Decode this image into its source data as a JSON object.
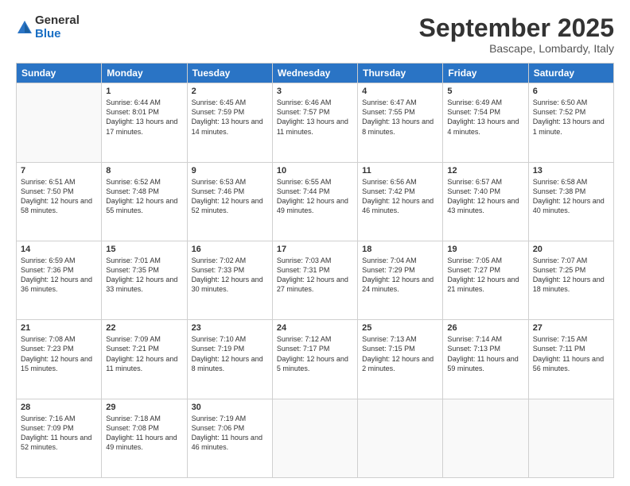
{
  "header": {
    "logo_general": "General",
    "logo_blue": "Blue",
    "month_title": "September 2025",
    "location": "Bascape, Lombardy, Italy"
  },
  "weekdays": [
    "Sunday",
    "Monday",
    "Tuesday",
    "Wednesday",
    "Thursday",
    "Friday",
    "Saturday"
  ],
  "weeks": [
    [
      {
        "day": "",
        "sunrise": "",
        "sunset": "",
        "daylight": ""
      },
      {
        "day": "1",
        "sunrise": "Sunrise: 6:44 AM",
        "sunset": "Sunset: 8:01 PM",
        "daylight": "Daylight: 13 hours and 17 minutes."
      },
      {
        "day": "2",
        "sunrise": "Sunrise: 6:45 AM",
        "sunset": "Sunset: 7:59 PM",
        "daylight": "Daylight: 13 hours and 14 minutes."
      },
      {
        "day": "3",
        "sunrise": "Sunrise: 6:46 AM",
        "sunset": "Sunset: 7:57 PM",
        "daylight": "Daylight: 13 hours and 11 minutes."
      },
      {
        "day": "4",
        "sunrise": "Sunrise: 6:47 AM",
        "sunset": "Sunset: 7:55 PM",
        "daylight": "Daylight: 13 hours and 8 minutes."
      },
      {
        "day": "5",
        "sunrise": "Sunrise: 6:49 AM",
        "sunset": "Sunset: 7:54 PM",
        "daylight": "Daylight: 13 hours and 4 minutes."
      },
      {
        "day": "6",
        "sunrise": "Sunrise: 6:50 AM",
        "sunset": "Sunset: 7:52 PM",
        "daylight": "Daylight: 13 hours and 1 minute."
      }
    ],
    [
      {
        "day": "7",
        "sunrise": "Sunrise: 6:51 AM",
        "sunset": "Sunset: 7:50 PM",
        "daylight": "Daylight: 12 hours and 58 minutes."
      },
      {
        "day": "8",
        "sunrise": "Sunrise: 6:52 AM",
        "sunset": "Sunset: 7:48 PM",
        "daylight": "Daylight: 12 hours and 55 minutes."
      },
      {
        "day": "9",
        "sunrise": "Sunrise: 6:53 AM",
        "sunset": "Sunset: 7:46 PM",
        "daylight": "Daylight: 12 hours and 52 minutes."
      },
      {
        "day": "10",
        "sunrise": "Sunrise: 6:55 AM",
        "sunset": "Sunset: 7:44 PM",
        "daylight": "Daylight: 12 hours and 49 minutes."
      },
      {
        "day": "11",
        "sunrise": "Sunrise: 6:56 AM",
        "sunset": "Sunset: 7:42 PM",
        "daylight": "Daylight: 12 hours and 46 minutes."
      },
      {
        "day": "12",
        "sunrise": "Sunrise: 6:57 AM",
        "sunset": "Sunset: 7:40 PM",
        "daylight": "Daylight: 12 hours and 43 minutes."
      },
      {
        "day": "13",
        "sunrise": "Sunrise: 6:58 AM",
        "sunset": "Sunset: 7:38 PM",
        "daylight": "Daylight: 12 hours and 40 minutes."
      }
    ],
    [
      {
        "day": "14",
        "sunrise": "Sunrise: 6:59 AM",
        "sunset": "Sunset: 7:36 PM",
        "daylight": "Daylight: 12 hours and 36 minutes."
      },
      {
        "day": "15",
        "sunrise": "Sunrise: 7:01 AM",
        "sunset": "Sunset: 7:35 PM",
        "daylight": "Daylight: 12 hours and 33 minutes."
      },
      {
        "day": "16",
        "sunrise": "Sunrise: 7:02 AM",
        "sunset": "Sunset: 7:33 PM",
        "daylight": "Daylight: 12 hours and 30 minutes."
      },
      {
        "day": "17",
        "sunrise": "Sunrise: 7:03 AM",
        "sunset": "Sunset: 7:31 PM",
        "daylight": "Daylight: 12 hours and 27 minutes."
      },
      {
        "day": "18",
        "sunrise": "Sunrise: 7:04 AM",
        "sunset": "Sunset: 7:29 PM",
        "daylight": "Daylight: 12 hours and 24 minutes."
      },
      {
        "day": "19",
        "sunrise": "Sunrise: 7:05 AM",
        "sunset": "Sunset: 7:27 PM",
        "daylight": "Daylight: 12 hours and 21 minutes."
      },
      {
        "day": "20",
        "sunrise": "Sunrise: 7:07 AM",
        "sunset": "Sunset: 7:25 PM",
        "daylight": "Daylight: 12 hours and 18 minutes."
      }
    ],
    [
      {
        "day": "21",
        "sunrise": "Sunrise: 7:08 AM",
        "sunset": "Sunset: 7:23 PM",
        "daylight": "Daylight: 12 hours and 15 minutes."
      },
      {
        "day": "22",
        "sunrise": "Sunrise: 7:09 AM",
        "sunset": "Sunset: 7:21 PM",
        "daylight": "Daylight: 12 hours and 11 minutes."
      },
      {
        "day": "23",
        "sunrise": "Sunrise: 7:10 AM",
        "sunset": "Sunset: 7:19 PM",
        "daylight": "Daylight: 12 hours and 8 minutes."
      },
      {
        "day": "24",
        "sunrise": "Sunrise: 7:12 AM",
        "sunset": "Sunset: 7:17 PM",
        "daylight": "Daylight: 12 hours and 5 minutes."
      },
      {
        "day": "25",
        "sunrise": "Sunrise: 7:13 AM",
        "sunset": "Sunset: 7:15 PM",
        "daylight": "Daylight: 12 hours and 2 minutes."
      },
      {
        "day": "26",
        "sunrise": "Sunrise: 7:14 AM",
        "sunset": "Sunset: 7:13 PM",
        "daylight": "Daylight: 11 hours and 59 minutes."
      },
      {
        "day": "27",
        "sunrise": "Sunrise: 7:15 AM",
        "sunset": "Sunset: 7:11 PM",
        "daylight": "Daylight: 11 hours and 56 minutes."
      }
    ],
    [
      {
        "day": "28",
        "sunrise": "Sunrise: 7:16 AM",
        "sunset": "Sunset: 7:09 PM",
        "daylight": "Daylight: 11 hours and 52 minutes."
      },
      {
        "day": "29",
        "sunrise": "Sunrise: 7:18 AM",
        "sunset": "Sunset: 7:08 PM",
        "daylight": "Daylight: 11 hours and 49 minutes."
      },
      {
        "day": "30",
        "sunrise": "Sunrise: 7:19 AM",
        "sunset": "Sunset: 7:06 PM",
        "daylight": "Daylight: 11 hours and 46 minutes."
      },
      {
        "day": "",
        "sunrise": "",
        "sunset": "",
        "daylight": ""
      },
      {
        "day": "",
        "sunrise": "",
        "sunset": "",
        "daylight": ""
      },
      {
        "day": "",
        "sunrise": "",
        "sunset": "",
        "daylight": ""
      },
      {
        "day": "",
        "sunrise": "",
        "sunset": "",
        "daylight": ""
      }
    ]
  ]
}
